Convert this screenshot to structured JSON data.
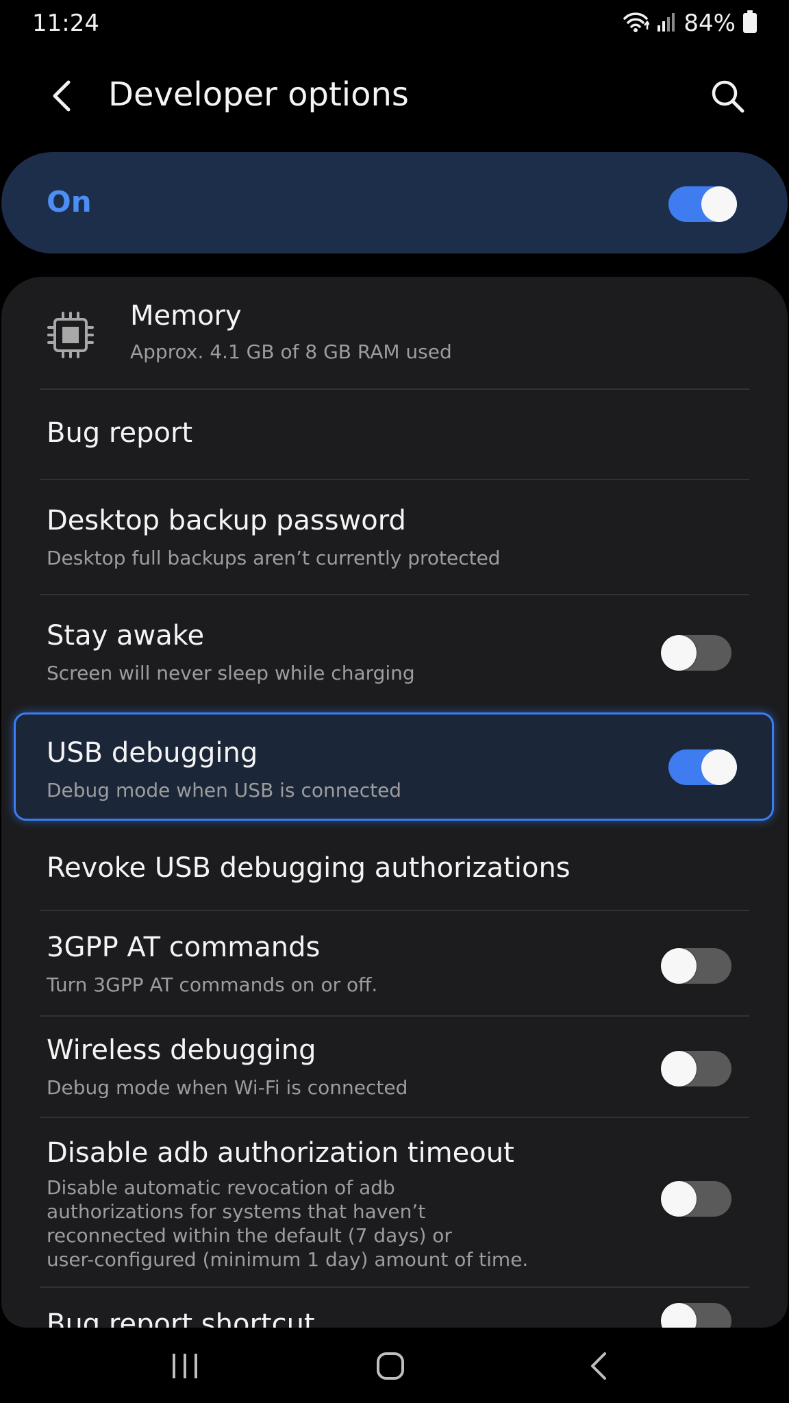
{
  "status_bar": {
    "time": "11:24",
    "battery": "84%",
    "icons": [
      "wifi-icon",
      "signal-icon",
      "battery-icon"
    ]
  },
  "header": {
    "title": "Developer options",
    "back_icon": "chevron-left-icon",
    "search_icon": "search-icon"
  },
  "master_switch": {
    "label": "On",
    "state": true
  },
  "settings": {
    "memory": {
      "title": "Memory",
      "subtitle": "Approx. 4.1 GB of 8 GB RAM used",
      "icon": "chip-icon"
    },
    "bug_report": {
      "title": "Bug report"
    },
    "desktop_backup": {
      "title": "Desktop backup password",
      "subtitle": "Desktop full backups aren’t currently protected"
    },
    "stay_awake": {
      "title": "Stay awake",
      "subtitle": "Screen will never sleep while charging",
      "state": false
    },
    "usb_debugging": {
      "title": "USB debugging",
      "subtitle": "Debug mode when USB is connected",
      "state": true
    },
    "revoke_usb": {
      "title": "Revoke USB debugging authorizations"
    },
    "at_commands": {
      "title": "3GPP AT commands",
      "subtitle": "Turn 3GPP AT commands on or off.",
      "state": false
    },
    "wireless_debugging": {
      "title": "Wireless debugging",
      "subtitle": "Debug mode when Wi-Fi is connected",
      "state": false
    },
    "adb_timeout": {
      "title": "Disable adb authorization timeout",
      "subtitle_lines": [
        "Disable automatic revocation of adb",
        "authorizations for systems that haven’t",
        "reconnected within the default (7 days) or",
        "user-configured (minimum 1 day) amount of time."
      ],
      "state": false
    },
    "bug_report_shortcut": {
      "title": "Bug report shortcut",
      "state": false
    }
  },
  "nav_bar": {
    "recents_icon": "recents-icon",
    "home_icon": "home-icon",
    "back_icon": "back-icon"
  },
  "colors": {
    "accent": "#3e7cf0",
    "master_bg": "#1c2e4a",
    "card_bg": "#1c1c1e",
    "highlight_border": "#3a7ef5"
  }
}
